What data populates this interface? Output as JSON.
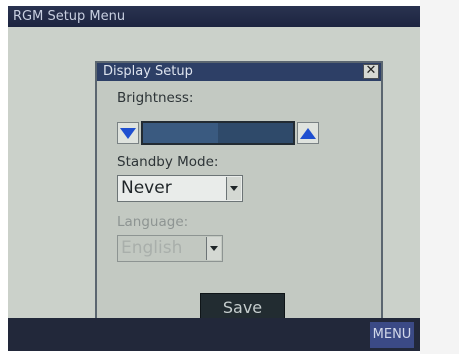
{
  "window": {
    "title": "RGM Setup Menu"
  },
  "dialog": {
    "title": "Display Setup",
    "close_glyph": "✕",
    "brightness": {
      "label": "Brightness:",
      "level": 0.5,
      "decrease_icon": "triangle-down-icon",
      "increase_icon": "triangle-up-icon"
    },
    "standby": {
      "label": "Standby Mode:",
      "value": "Never"
    },
    "language": {
      "label": "Language:",
      "value": "English",
      "enabled": false
    },
    "save_label": "Save"
  },
  "taskbar": {
    "menu_label": "MENU"
  },
  "colors": {
    "titlebar": "#1c2440",
    "dialog_title": "#2d3f66",
    "arrow_blue": "#1f4fd0",
    "menu_button": "#3b4a86"
  }
}
